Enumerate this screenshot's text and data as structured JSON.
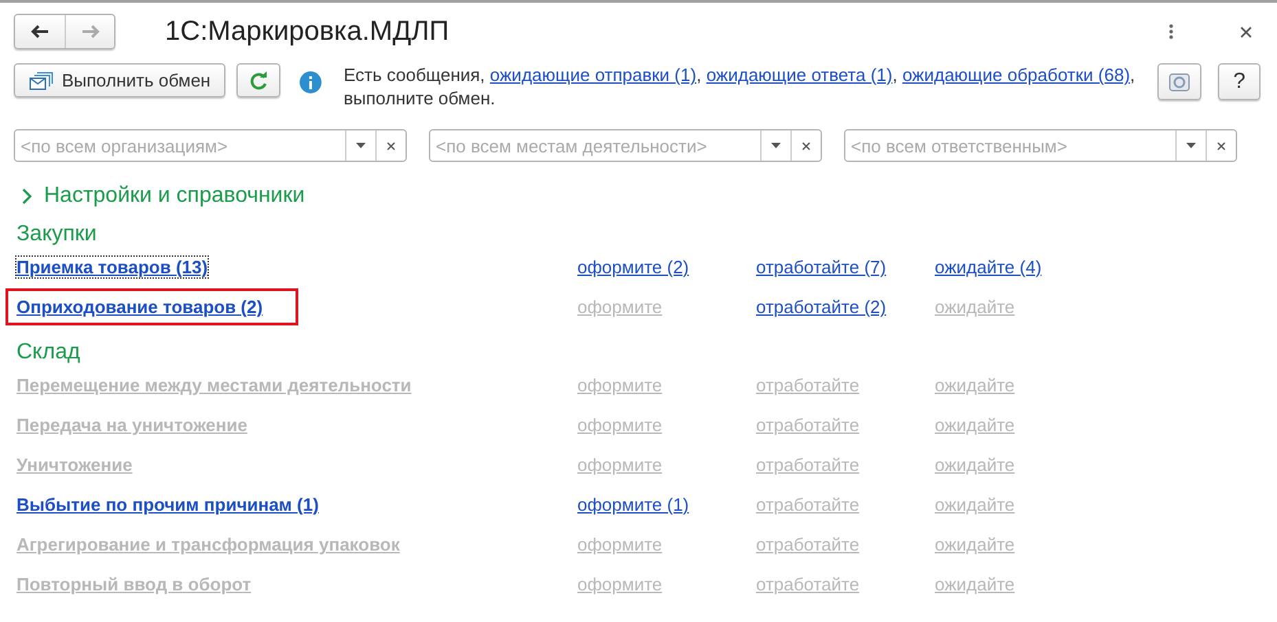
{
  "window": {
    "title": "1С:Маркировка.МДЛП"
  },
  "toolbar": {
    "exchange_button": "Выполнить обмен",
    "help_button": "?"
  },
  "message": [
    {
      "text": "Есть сообщения, ",
      "kind": "text"
    },
    {
      "text": "ожидающие отправки (1)",
      "kind": "link"
    },
    {
      "text": ", ",
      "kind": "text"
    },
    {
      "text": "ожидающие ответа (1)",
      "kind": "link"
    },
    {
      "text": ", ",
      "kind": "text"
    },
    {
      "text": "ожидающие обработки (68)",
      "kind": "link"
    },
    {
      "text": ", выполните обмен.",
      "kind": "text"
    }
  ],
  "filters": [
    {
      "placeholder": "<по всем организациям>"
    },
    {
      "placeholder": "<по всем местам деятельности>"
    },
    {
      "placeholder": "<по всем ответственным>"
    }
  ],
  "settings_group": {
    "label": "Настройки и справочники",
    "expanded": false
  },
  "sections": [
    {
      "title": "Закупки",
      "rows": [
        {
          "name": "Приемка товаров (13)",
          "active": true,
          "focused": true,
          "highlighted": false,
          "links": [
            {
              "text": "оформите (2)",
              "active": true
            },
            {
              "text": "отработайте (7)",
              "active": true
            },
            {
              "text": "ожидайте (4)",
              "active": true
            }
          ]
        },
        {
          "name": "Оприходование товаров (2)",
          "active": true,
          "focused": false,
          "highlighted": true,
          "links": [
            {
              "text": "оформите",
              "active": false
            },
            {
              "text": "отработайте (2)",
              "active": true
            },
            {
              "text": "ожидайте",
              "active": false
            }
          ]
        }
      ]
    },
    {
      "title": "Склад",
      "rows": [
        {
          "name": "Перемещение между местами деятельности",
          "active": false,
          "focused": false,
          "highlighted": false,
          "links": [
            {
              "text": "оформите",
              "active": false
            },
            {
              "text": "отработайте",
              "active": false
            },
            {
              "text": "ожидайте",
              "active": false
            }
          ]
        },
        {
          "name": "Передача на уничтожение",
          "active": false,
          "focused": false,
          "highlighted": false,
          "links": [
            {
              "text": "оформите",
              "active": false
            },
            {
              "text": "отработайте",
              "active": false
            },
            {
              "text": "ожидайте",
              "active": false
            }
          ]
        },
        {
          "name": "Уничтожение",
          "active": false,
          "focused": false,
          "highlighted": false,
          "links": [
            {
              "text": "оформите",
              "active": false
            },
            {
              "text": "отработайте",
              "active": false
            },
            {
              "text": "ожидайте",
              "active": false
            }
          ]
        },
        {
          "name": "Выбытие по прочим причинам (1)",
          "active": true,
          "focused": false,
          "highlighted": false,
          "links": [
            {
              "text": "оформите (1)",
              "active": true
            },
            {
              "text": "отработайте",
              "active": false
            },
            {
              "text": "ожидайте",
              "active": false
            }
          ]
        },
        {
          "name": "Агрегирование и трансформация упаковок",
          "active": false,
          "focused": false,
          "highlighted": false,
          "links": [
            {
              "text": "оформите",
              "active": false
            },
            {
              "text": "отработайте",
              "active": false
            },
            {
              "text": "ожидайте",
              "active": false
            }
          ]
        },
        {
          "name": "Повторный ввод в оборот",
          "active": false,
          "focused": false,
          "highlighted": false,
          "links": [
            {
              "text": "оформите",
              "active": false
            },
            {
              "text": "отработайте",
              "active": false
            },
            {
              "text": "ожидайте",
              "active": false
            }
          ]
        }
      ]
    }
  ]
}
